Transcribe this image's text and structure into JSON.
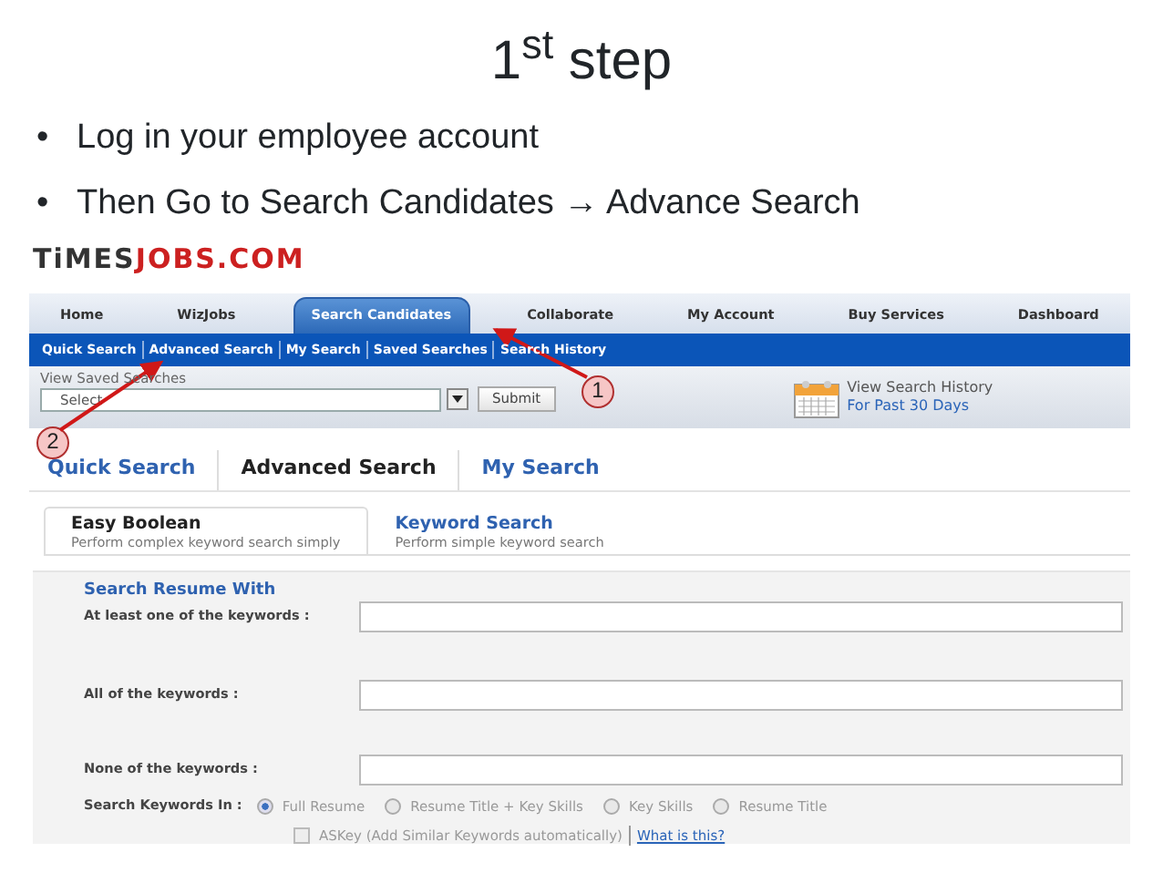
{
  "slide": {
    "title": "1$^{st}$ step",
    "bullets": [
      {
        "marker": "•",
        "text": "Log in your employee account"
      },
      {
        "marker": "•",
        "text": "Then Go to Search Candidates → Advance Search"
      }
    ]
  },
  "site": {
    "logo": {
      "part_1": "TiMES",
      "part_2": "JOBS.COM"
    },
    "top_nav": [
      {
        "label": "Home",
        "selected": false
      },
      {
        "label": "WizJobs",
        "selected": false
      },
      {
        "label": "Search Candidates",
        "selected": true
      },
      {
        "label": "Collaborate",
        "selected": false
      },
      {
        "label": "My Account",
        "selected": false
      },
      {
        "label": "Buy Services",
        "selected": false
      },
      {
        "label": "Dashboard",
        "selected": false
      }
    ],
    "sub_nav": [
      "Quick Search",
      "Advanced Search",
      "My Search",
      "Saved Searches",
      "Search History"
    ],
    "saved_searches": {
      "label": "View Saved Searches",
      "value": "Select",
      "button": "Submit"
    },
    "history": {
      "line_1": "View Search History",
      "line_2": "For Past 30 Days"
    },
    "search_tabs": [
      {
        "label": "Quick Search",
        "selected": false
      },
      {
        "label": "Advanced Search",
        "selected": true
      },
      {
        "label": "My Search",
        "selected": false
      }
    ],
    "mode_tabs": [
      {
        "title": "Easy Boolean",
        "description": "Perform complex keyword search simply",
        "selected": true
      },
      {
        "title": "Keyword Search",
        "description": "Perform simple keyword search",
        "selected": false
      }
    ],
    "form": {
      "heading": "Search Resume With",
      "fields": [
        {
          "label": "At least one of the keywords :"
        },
        {
          "label": "All of the keywords :"
        },
        {
          "label": "None of the keywords :"
        }
      ],
      "search_in": {
        "label": "Search Keywords In :",
        "options": [
          {
            "label": "Full Resume",
            "selected": true
          },
          {
            "label": "Resume Title + Key Skills",
            "selected": false
          },
          {
            "label": "Key Skills",
            "selected": false
          },
          {
            "label": "Resume Title",
            "selected": false
          }
        ]
      },
      "askey": {
        "label": "ASKey (Add Similar Keywords automatically)",
        "checked": false,
        "link": "What is this?"
      }
    }
  },
  "callouts": [
    {
      "number": "1"
    },
    {
      "number": "2"
    }
  ]
}
